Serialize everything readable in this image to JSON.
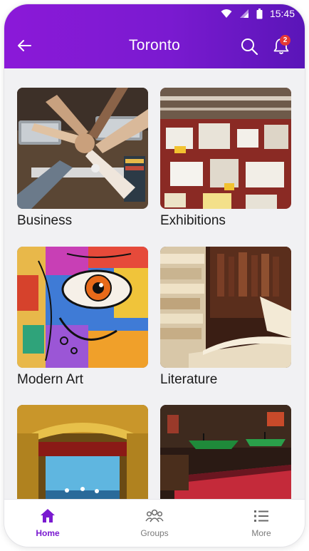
{
  "status": {
    "time": "15:45"
  },
  "header": {
    "title": "Toronto",
    "notification_count": "2"
  },
  "icons": {
    "back": "arrow-left-icon",
    "search": "search-icon",
    "notifications": "bell-icon"
  },
  "categories": [
    {
      "label": "Business"
    },
    {
      "label": "Exhibitions"
    },
    {
      "label": "Modern Art"
    },
    {
      "label": "Literature"
    },
    {
      "label": ""
    },
    {
      "label": ""
    }
  ],
  "tabs": [
    {
      "label": "Home",
      "icon": "home-icon",
      "active": true
    },
    {
      "label": "Groups",
      "icon": "groups-icon",
      "active": false
    },
    {
      "label": "More",
      "icon": "list-icon",
      "active": false
    }
  ],
  "colors": {
    "primary": "#7a1ad0",
    "badge": "#e53935"
  }
}
